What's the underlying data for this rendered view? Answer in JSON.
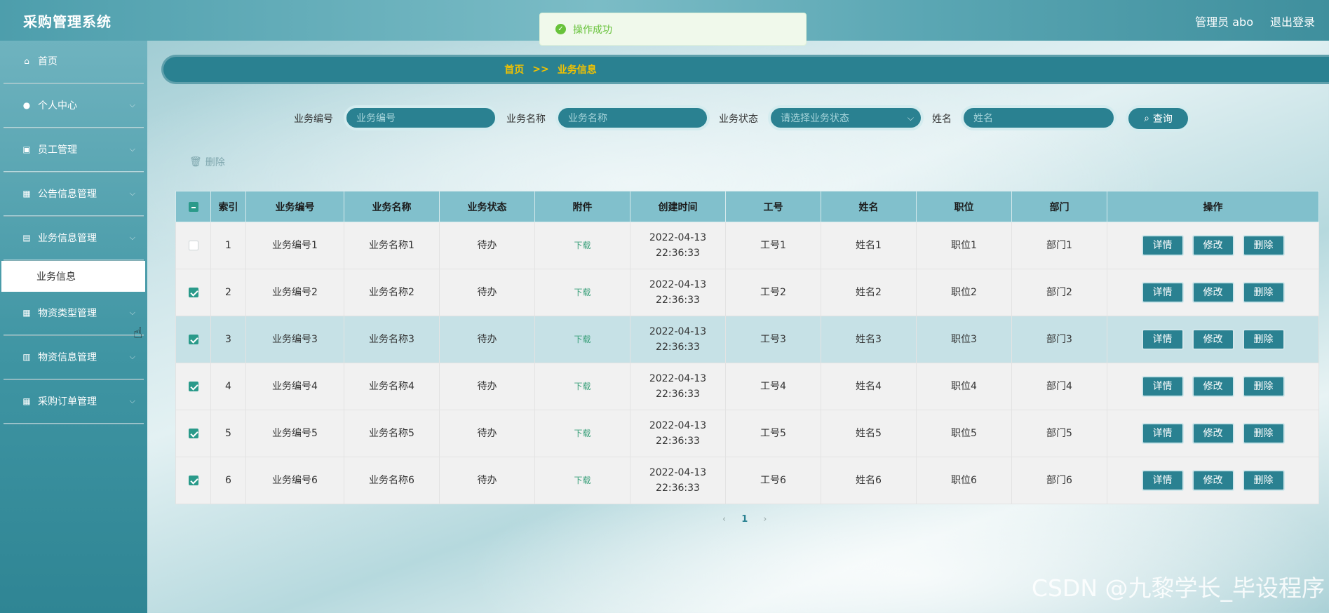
{
  "header": {
    "title": "采购管理系统",
    "user": "管理员 abo",
    "logout": "退出登录"
  },
  "toast": {
    "message": "操作成功"
  },
  "sidebar": {
    "items": [
      {
        "label": "首页",
        "icon": "home-icon",
        "glyph": "⌂",
        "chevron": false
      },
      {
        "label": "个人中心",
        "icon": "user-icon",
        "glyph": "●",
        "chevron": true
      },
      {
        "label": "员工管理",
        "icon": "staff-icon",
        "glyph": "▣",
        "chevron": true
      },
      {
        "label": "公告信息管理",
        "icon": "grid-icon",
        "glyph": "▦",
        "chevron": true
      },
      {
        "label": "业务信息管理",
        "icon": "briefcase-icon",
        "glyph": "▤",
        "chevron": true
      },
      {
        "label": "物资类型管理",
        "icon": "grid-icon",
        "glyph": "▦",
        "chevron": true
      },
      {
        "label": "物资信息管理",
        "icon": "clipboard-icon",
        "glyph": "▥",
        "chevron": true
      },
      {
        "label": "采购订单管理",
        "icon": "grid-icon",
        "glyph": "▦",
        "chevron": true
      }
    ],
    "active_sub": "业务信息"
  },
  "breadcrumb": {
    "home": "首页",
    "sep": ">>",
    "current": "业务信息"
  },
  "search": {
    "fields": [
      {
        "label": "业务编号",
        "placeholder": "业务编号"
      },
      {
        "label": "业务名称",
        "placeholder": "业务名称"
      },
      {
        "label": "业务状态",
        "placeholder": "请选择业务状态"
      },
      {
        "label": "姓名",
        "placeholder": "姓名"
      }
    ],
    "button": "查询"
  },
  "toolbar": {
    "delete": "删除"
  },
  "table": {
    "headers": [
      "索引",
      "业务编号",
      "业务名称",
      "业务状态",
      "附件",
      "创建时间",
      "工号",
      "姓名",
      "职位",
      "部门",
      "操作"
    ],
    "actions": [
      "详情",
      "修改",
      "删除"
    ],
    "rows": [
      {
        "checked": false,
        "index": "1",
        "code": "业务编号1",
        "name": "业务名称1",
        "status": "待办",
        "file": "下载",
        "time": "2022-04-13 22:36:33",
        "job_no": "工号1",
        "person": "姓名1",
        "position": "职位1",
        "dept": "部门1"
      },
      {
        "checked": true,
        "index": "2",
        "code": "业务编号2",
        "name": "业务名称2",
        "status": "待办",
        "file": "下载",
        "time": "2022-04-13 22:36:33",
        "job_no": "工号2",
        "person": "姓名2",
        "position": "职位2",
        "dept": "部门2"
      },
      {
        "checked": true,
        "index": "3",
        "code": "业务编号3",
        "name": "业务名称3",
        "status": "待办",
        "file": "下载",
        "time": "2022-04-13 22:36:33",
        "job_no": "工号3",
        "person": "姓名3",
        "position": "职位3",
        "dept": "部门3"
      },
      {
        "checked": true,
        "index": "4",
        "code": "业务编号4",
        "name": "业务名称4",
        "status": "待办",
        "file": "下载",
        "time": "2022-04-13 22:36:33",
        "job_no": "工号4",
        "person": "姓名4",
        "position": "职位4",
        "dept": "部门4"
      },
      {
        "checked": true,
        "index": "5",
        "code": "业务编号5",
        "name": "业务名称5",
        "status": "待办",
        "file": "下载",
        "time": "2022-04-13 22:36:33",
        "job_no": "工号5",
        "person": "姓名5",
        "position": "职位5",
        "dept": "部门5"
      },
      {
        "checked": true,
        "index": "6",
        "code": "业务编号6",
        "name": "业务名称6",
        "status": "待办",
        "file": "下载",
        "time": "2022-04-13 22:36:33",
        "job_no": "工号6",
        "person": "姓名6",
        "position": "职位6",
        "dept": "部门6"
      }
    ]
  },
  "pagination": {
    "current": "1"
  },
  "watermark": "CSDN @九黎学长_毕设程序"
}
